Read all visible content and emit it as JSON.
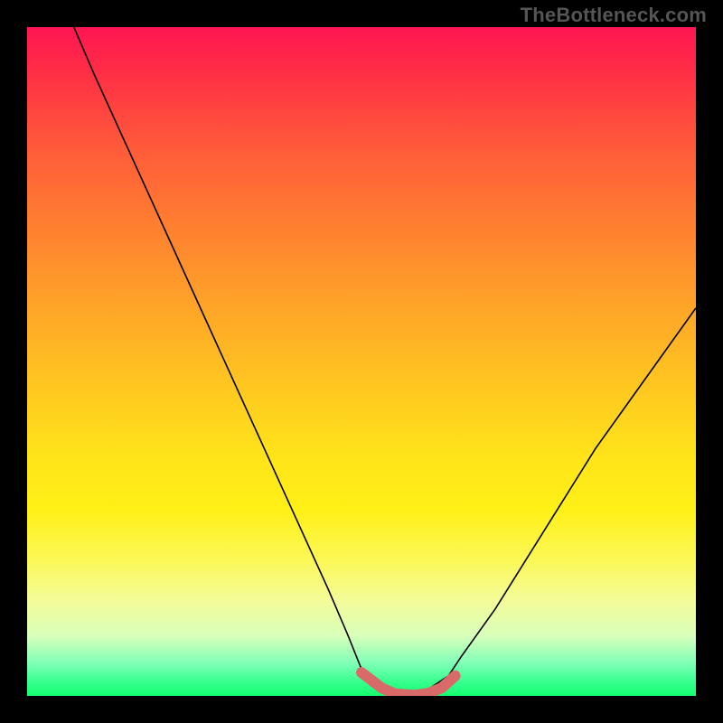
{
  "watermark": "TheBottleneck.com",
  "chart_data": {
    "type": "line",
    "title": "",
    "xlabel": "",
    "ylabel": "",
    "xlim": [
      0,
      1
    ],
    "ylim": [
      0,
      1
    ],
    "background": "vertical-gradient red→orange→yellow→green (worst→best)",
    "series": [
      {
        "name": "bottleneck-curve",
        "x": [
          0.07,
          0.1,
          0.15,
          0.2,
          0.25,
          0.3,
          0.35,
          0.4,
          0.45,
          0.48,
          0.5,
          0.53,
          0.55,
          0.58,
          0.6,
          0.63,
          0.65,
          0.7,
          0.75,
          0.8,
          0.85,
          0.9,
          0.95,
          1.0
        ],
        "values": [
          1.0,
          0.93,
          0.82,
          0.71,
          0.6,
          0.49,
          0.38,
          0.27,
          0.16,
          0.09,
          0.04,
          0.01,
          0.0,
          0.0,
          0.01,
          0.03,
          0.06,
          0.13,
          0.21,
          0.29,
          0.37,
          0.44,
          0.51,
          0.58
        ]
      }
    ],
    "highlight": {
      "name": "optimum-range",
      "x": [
        0.5,
        0.53,
        0.55,
        0.58,
        0.6,
        0.62,
        0.64
      ],
      "values": [
        0.035,
        0.012,
        0.003,
        0.001,
        0.004,
        0.012,
        0.03
      ]
    }
  }
}
